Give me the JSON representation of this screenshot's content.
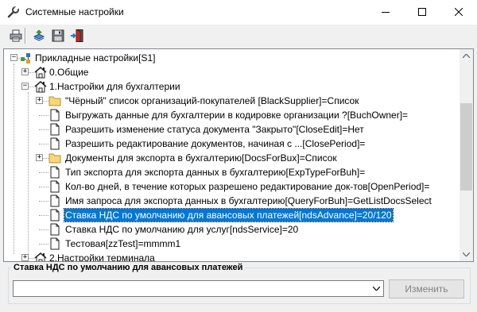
{
  "window": {
    "title": "Системные настройки",
    "icon": "wrench-icon",
    "controls": [
      "minimize-icon",
      "maximize-icon",
      "close-icon"
    ]
  },
  "toolbar": {
    "buttons": [
      {
        "name": "print-button",
        "icon": "printer-icon"
      },
      {
        "name": "import-button",
        "icon": "upload-icon"
      },
      {
        "name": "save-button",
        "icon": "floppy-disk-icon"
      },
      {
        "name": "exit-button",
        "icon": "exit-door-icon"
      }
    ]
  },
  "tree": {
    "nodes": [
      {
        "label": "Прикладные настройки[S1]",
        "level": 0,
        "type": "root",
        "expander": "-"
      },
      {
        "label": "0.Общие",
        "level": 1,
        "type": "home",
        "expander": "+"
      },
      {
        "label": "1.Настройки для бухгалтерии",
        "level": 1,
        "type": "home",
        "expander": "-"
      },
      {
        "label": "\"Чёрный\" список организаций-покупателей [BlackSupplier]=Список",
        "level": 2,
        "type": "folder",
        "expander": "+"
      },
      {
        "label": "Выгружать данные для бухгалтерии в кодировке организации ?[BuchOwner]=",
        "level": 2,
        "type": "doc"
      },
      {
        "label": "Разрешить изменение статуса документа \"Закрыто\"[CloseEdit]=Нет",
        "level": 2,
        "type": "doc"
      },
      {
        "label": "Разрешить редактирование документов, начиная с ...[ClosePeriod]=",
        "level": 2,
        "type": "doc"
      },
      {
        "label": "Документы для экспорта в бухгалтерию[DocsForBux]=Список",
        "level": 2,
        "type": "folder",
        "expander": "+"
      },
      {
        "label": "Тип экспорта для экспорта данных в бухгалтерию[ExpTypeForBuh]=",
        "level": 2,
        "type": "doc"
      },
      {
        "label": "Кол-во дней, в течение которых разрешено редактирование док-тов[OpenPeriod]=",
        "level": 2,
        "type": "doc"
      },
      {
        "label": "Имя запроса для экспорта данных в бухгалтерию[QueryForBuh]=GetListDocsSelect",
        "level": 2,
        "type": "doc"
      },
      {
        "label": "Ставка НДС по умолчанию для авансовых платежей[ndsAdvance]=20/120",
        "level": 2,
        "type": "doc",
        "selected": true
      },
      {
        "label": "Ставка НДС по умолчанию для услуг[ndsService]=20",
        "level": 2,
        "type": "doc"
      },
      {
        "label": "Тестовая[zzTest]=mmmm1",
        "level": 2,
        "type": "doc"
      },
      {
        "label": "2.Настройки терминала",
        "level": 1,
        "type": "home",
        "expander": "+"
      }
    ]
  },
  "editor": {
    "group_caption": "Ставка НДС по умолчанию для авансовых платежей",
    "combo_value": "",
    "change_button": "Изменить"
  },
  "colors": {
    "selection": "#0078d7",
    "folder": "#f8d775",
    "exit_door": "#c42b1c"
  }
}
